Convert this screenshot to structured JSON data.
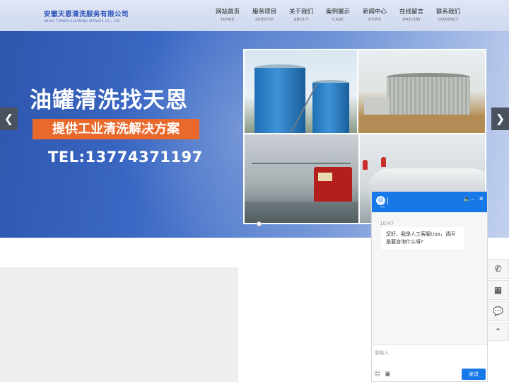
{
  "header": {
    "company_cn": "安徽天恩清洗服务有限公司",
    "company_en": "ANHUI TIANEN CLEANING SERVICE CO., LTD",
    "nav": [
      {
        "cn": "网站首页",
        "en": "HOME"
      },
      {
        "cn": "服务项目",
        "en": "SERVICE"
      },
      {
        "cn": "关于我们",
        "en": "ABOUT"
      },
      {
        "cn": "案例展示",
        "en": "CASE"
      },
      {
        "cn": "新闻中心",
        "en": "NEWS"
      },
      {
        "cn": "在线留言",
        "en": "INQUIRY"
      },
      {
        "cn": "联系我们",
        "en": "CONTACT"
      }
    ]
  },
  "banner": {
    "headline": "油罐清洗找天恩",
    "subline": "提供工业清洗解决方案",
    "tel": "TEL:13774371197",
    "prev_icon": "chevron-left-icon",
    "next_icon": "chevron-right-icon",
    "colors": {
      "accent": "#e8692b",
      "background": "#3a68c4"
    }
  },
  "chat": {
    "time": "10:47",
    "message": "您好，我是人工客服Lisa，请问是要咨询什么呀?",
    "placeholder": "请输入",
    "send_label": "发送",
    "icons": [
      "speaker-icon",
      "minimize-icon",
      "close-icon",
      "emoji-icon",
      "image-icon"
    ],
    "color": "#1778e8"
  },
  "side_tools": [
    "phone-icon",
    "qrcode-icon",
    "chat-bubble-icon",
    "chevron-up-icon"
  ]
}
